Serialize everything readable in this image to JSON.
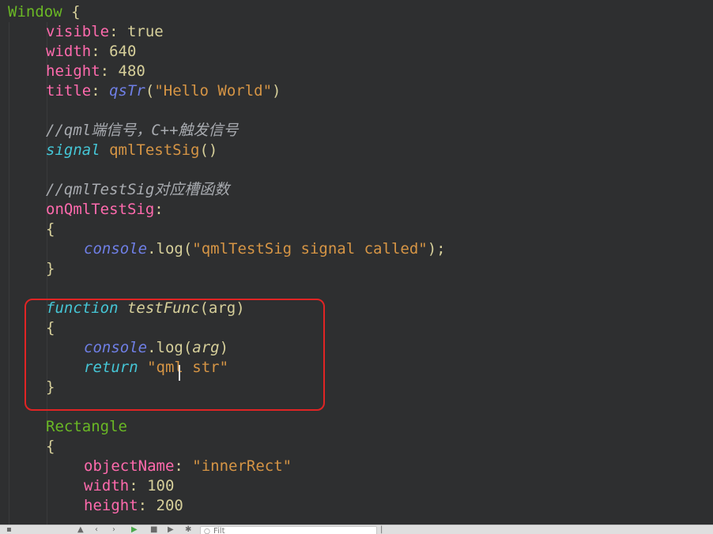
{
  "colors": {
    "background": "#2e2f30",
    "default": "#d6cf9a",
    "type": "#6ab825",
    "property": "#ff6aad",
    "number": "#d6cf9a",
    "string": "#d69545",
    "italic_blue": "#6f7fe6",
    "keyword": "#45c6d6",
    "comment": "#a8abb0",
    "highlight_border": "#e02424"
  },
  "code_lines": [
    {
      "indent": 0,
      "tokens": [
        {
          "t": "Window",
          "c": "type"
        },
        {
          "t": " {",
          "c": "default"
        }
      ]
    },
    {
      "indent": 1,
      "tokens": [
        {
          "t": "visible",
          "c": "property"
        },
        {
          "t": ": true",
          "c": "default"
        }
      ]
    },
    {
      "indent": 1,
      "tokens": [
        {
          "t": "width",
          "c": "property"
        },
        {
          "t": ": 640",
          "c": "default"
        }
      ]
    },
    {
      "indent": 1,
      "tokens": [
        {
          "t": "height",
          "c": "property"
        },
        {
          "t": ": 480",
          "c": "default"
        }
      ]
    },
    {
      "indent": 1,
      "tokens": [
        {
          "t": "title",
          "c": "property"
        },
        {
          "t": ": ",
          "c": "default"
        },
        {
          "t": "qsTr",
          "c": "italic_blue",
          "i": true
        },
        {
          "t": "(",
          "c": "default"
        },
        {
          "t": "\"Hello World\"",
          "c": "string"
        },
        {
          "t": ")",
          "c": "default"
        }
      ]
    },
    {
      "indent": 0,
      "tokens": []
    },
    {
      "indent": 1,
      "tokens": [
        {
          "t": "//qml端信号，C++触发信号",
          "c": "comment",
          "i": true
        }
      ]
    },
    {
      "indent": 1,
      "tokens": [
        {
          "t": "signal",
          "c": "keyword",
          "i": true
        },
        {
          "t": " qmlTestSig",
          "c": "string"
        },
        {
          "t": "()",
          "c": "default"
        }
      ]
    },
    {
      "indent": 0,
      "tokens": []
    },
    {
      "indent": 1,
      "tokens": [
        {
          "t": "//qmlTestSig对应槽函数",
          "c": "comment",
          "i": true
        }
      ]
    },
    {
      "indent": 1,
      "tokens": [
        {
          "t": "onQmlTestSig",
          "c": "property"
        },
        {
          "t": ":",
          "c": "default"
        }
      ]
    },
    {
      "indent": 1,
      "tokens": [
        {
          "t": "{",
          "c": "default"
        }
      ]
    },
    {
      "indent": 2,
      "tokens": [
        {
          "t": "console",
          "c": "italic_blue",
          "i": true
        },
        {
          "t": ".log(",
          "c": "default"
        },
        {
          "t": "\"qmlTestSig signal called\"",
          "c": "string"
        },
        {
          "t": ");",
          "c": "default"
        }
      ]
    },
    {
      "indent": 1,
      "tokens": [
        {
          "t": "}",
          "c": "default"
        }
      ]
    },
    {
      "indent": 0,
      "tokens": []
    },
    {
      "indent": 1,
      "tokens": [
        {
          "t": "function",
          "c": "keyword",
          "i": true
        },
        {
          "t": " ",
          "c": "default"
        },
        {
          "t": "testFunc",
          "c": "default",
          "i": true
        },
        {
          "t": "(arg)",
          "c": "default"
        }
      ]
    },
    {
      "indent": 1,
      "tokens": [
        {
          "t": "{",
          "c": "default"
        }
      ]
    },
    {
      "indent": 2,
      "tokens": [
        {
          "t": "console",
          "c": "italic_blue",
          "i": true
        },
        {
          "t": ".log(",
          "c": "default"
        },
        {
          "t": "arg",
          "c": "default",
          "i": true
        },
        {
          "t": ")",
          "c": "default"
        }
      ]
    },
    {
      "indent": 2,
      "tokens": [
        {
          "t": "return",
          "c": "keyword",
          "i": true
        },
        {
          "t": " ",
          "c": "default"
        },
        {
          "t": "\"qml str\"",
          "c": "string"
        }
      ]
    },
    {
      "indent": 1,
      "tokens": [
        {
          "t": "}",
          "c": "default"
        }
      ]
    },
    {
      "indent": 0,
      "tokens": []
    },
    {
      "indent": 1,
      "tokens": [
        {
          "t": "Rectangle",
          "c": "type"
        }
      ]
    },
    {
      "indent": 1,
      "tokens": [
        {
          "t": "{",
          "c": "default"
        }
      ]
    },
    {
      "indent": 2,
      "tokens": [
        {
          "t": "objectName",
          "c": "property"
        },
        {
          "t": ": ",
          "c": "default"
        },
        {
          "t": "\"innerRect\"",
          "c": "string"
        }
      ]
    },
    {
      "indent": 2,
      "tokens": [
        {
          "t": "width",
          "c": "property"
        },
        {
          "t": ": 100",
          "c": "default"
        }
      ]
    },
    {
      "indent": 2,
      "tokens": [
        {
          "t": "height",
          "c": "property"
        },
        {
          "t": ": 200",
          "c": "default"
        }
      ]
    }
  ],
  "toolbar": {
    "filter_placeholder": "Filt",
    "filter_icon": "search-icon",
    "icons": [
      "menu-icon",
      "up-icon",
      "back-icon",
      "forward-icon",
      "run-icon",
      "stop-icon",
      "next-icon",
      "settings-icon"
    ]
  }
}
